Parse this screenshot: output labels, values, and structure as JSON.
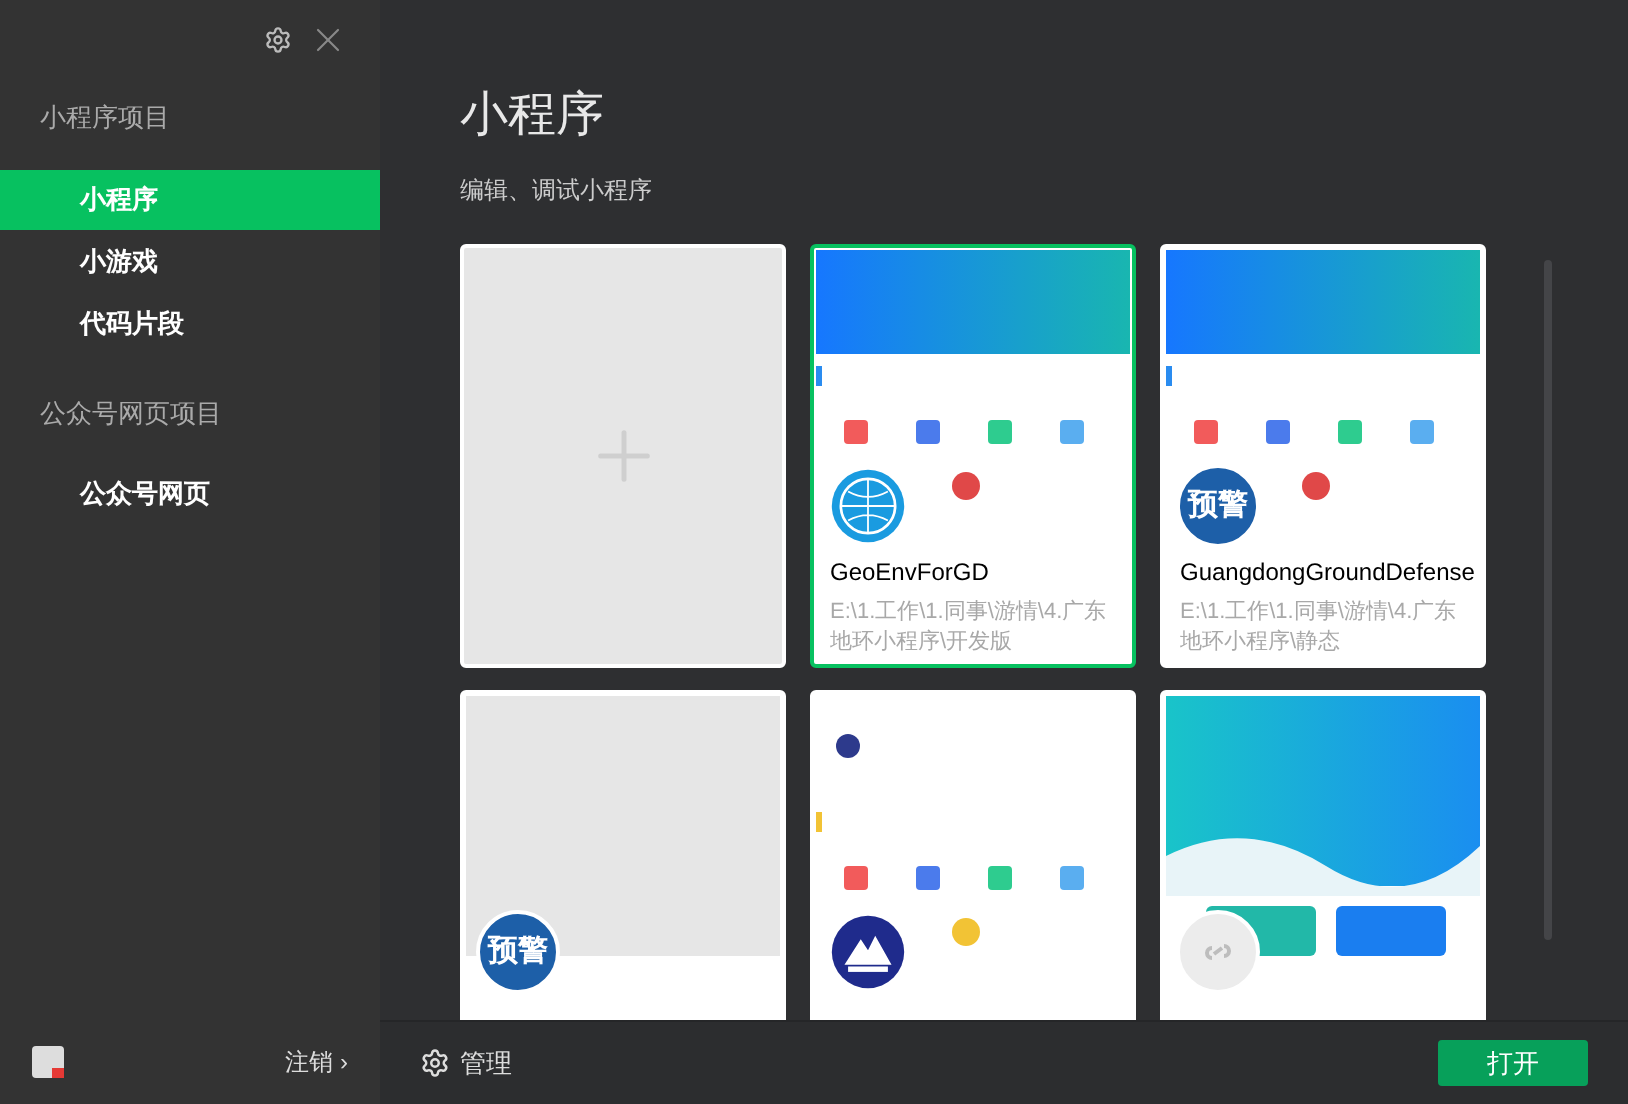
{
  "sidebar": {
    "groups": [
      {
        "title": "小程序项目",
        "items": [
          {
            "label": "小程序",
            "selected": true
          },
          {
            "label": "小游戏",
            "selected": false
          },
          {
            "label": "代码片段",
            "selected": false
          }
        ]
      },
      {
        "title": "公众号网页项目",
        "items": [
          {
            "label": "公众号网页",
            "selected": false
          }
        ]
      }
    ],
    "logout": "注销 ›"
  },
  "main": {
    "title": "小程序",
    "subtitle": "编辑、调试小程序",
    "cards": [
      {
        "kind": "add",
        "selected": false
      },
      {
        "kind": "project",
        "selected": true,
        "thumb": {
          "kind": "gradient"
        },
        "avatar": {
          "kind": "globe"
        },
        "name": "GeoEnvForGD",
        "path": "E:\\1.工作\\1.同事\\游情\\4.广东地环小程序\\开发版"
      },
      {
        "kind": "project",
        "selected": false,
        "thumb": {
          "kind": "gradient"
        },
        "avatar": {
          "kind": "label",
          "text": "预警"
        },
        "name": "GuangdongGroundDefense",
        "path": "E:\\1.工作\\1.同事\\游情\\4.广东地环小程序\\静态"
      },
      {
        "kind": "project",
        "selected": false,
        "thumb": {
          "kind": "blank"
        },
        "avatar": {
          "kind": "label",
          "text": "预警"
        }
      },
      {
        "kind": "project",
        "selected": false,
        "thumb": {
          "kind": "white"
        },
        "avatar": {
          "kind": "mountain"
        }
      },
      {
        "kind": "project",
        "selected": false,
        "thumb": {
          "kind": "teal"
        },
        "avatar": {
          "kind": "placeholder"
        }
      }
    ]
  },
  "bottom_bar": {
    "manage": "管理",
    "open_button": "打开"
  }
}
